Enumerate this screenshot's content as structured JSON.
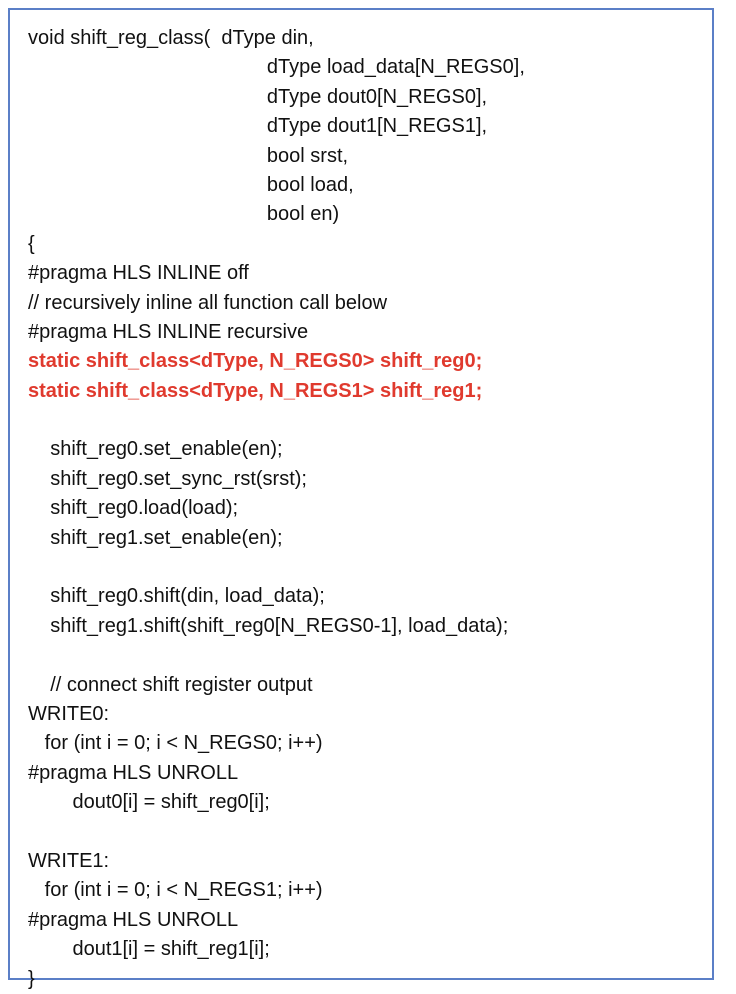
{
  "document": {
    "highlight_color": "#e03a2e",
    "border_color": "#5b7fc7",
    "lines": [
      {
        "text": "void shift_reg_class(  dType din,",
        "style": "normal"
      },
      {
        "text": "                                           dType load_data[N_REGS0],",
        "style": "normal"
      },
      {
        "text": "                                           dType dout0[N_REGS0],",
        "style": "normal"
      },
      {
        "text": "                                           dType dout1[N_REGS1],",
        "style": "normal"
      },
      {
        "text": "                                           bool srst,",
        "style": "normal"
      },
      {
        "text": "                                           bool load,",
        "style": "normal"
      },
      {
        "text": "                                           bool en)",
        "style": "normal"
      },
      {
        "text": "{",
        "style": "normal"
      },
      {
        "text": "#pragma HLS INLINE off",
        "style": "normal"
      },
      {
        "text": "// recursively inline all function call below",
        "style": "normal"
      },
      {
        "text": "#pragma HLS INLINE recursive",
        "style": "normal"
      },
      {
        "text": "static shift_class<dType, N_REGS0> shift_reg0;",
        "style": "highlight"
      },
      {
        "text": "static shift_class<dType, N_REGS1> shift_reg1;",
        "style": "highlight"
      },
      {
        "text": "",
        "style": "blank"
      },
      {
        "text": "    shift_reg0.set_enable(en);",
        "style": "normal"
      },
      {
        "text": "    shift_reg0.set_sync_rst(srst);",
        "style": "normal"
      },
      {
        "text": "    shift_reg0.load(load);",
        "style": "normal"
      },
      {
        "text": "    shift_reg1.set_enable(en);",
        "style": "normal"
      },
      {
        "text": "",
        "style": "blank"
      },
      {
        "text": "    shift_reg0.shift(din, load_data);",
        "style": "normal"
      },
      {
        "text": "    shift_reg1.shift(shift_reg0[N_REGS0-1], load_data);",
        "style": "normal"
      },
      {
        "text": "",
        "style": "blank"
      },
      {
        "text": "    // connect shift register output",
        "style": "normal"
      },
      {
        "text": "WRITE0:",
        "style": "normal"
      },
      {
        "text": "   for (int i = 0; i < N_REGS0; i++)",
        "style": "normal"
      },
      {
        "text": "#pragma HLS UNROLL",
        "style": "normal"
      },
      {
        "text": "        dout0[i] = shift_reg0[i];",
        "style": "normal"
      },
      {
        "text": "",
        "style": "blank"
      },
      {
        "text": "WRITE1:",
        "style": "normal"
      },
      {
        "text": "   for (int i = 0; i < N_REGS1; i++)",
        "style": "normal"
      },
      {
        "text": "#pragma HLS UNROLL",
        "style": "normal"
      },
      {
        "text": "        dout1[i] = shift_reg1[i];",
        "style": "normal"
      },
      {
        "text": "}",
        "style": "normal"
      }
    ]
  }
}
